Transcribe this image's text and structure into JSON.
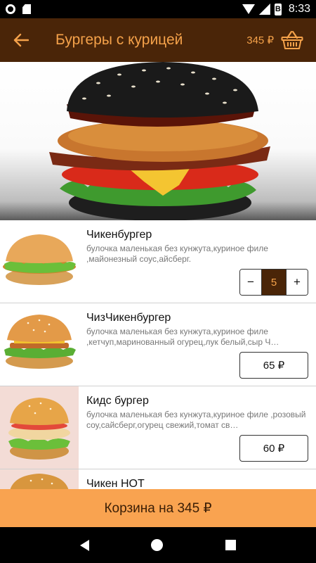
{
  "status_bar": {
    "time": "8:33",
    "battery_glyph": "B"
  },
  "app_bar": {
    "title": "Бургеры с курицей",
    "cart_total": "345 ₽"
  },
  "items": [
    {
      "name": "Чикенбургер",
      "description": "булочка маленькая без кунжута,куриное филе ,майонезный соус,айсберг.",
      "quantity": "5",
      "minus": "−",
      "plus": "+"
    },
    {
      "name": "ЧизЧикенбургер",
      "description": "булочка маленькая без кунжута,куриное филе ,кетчуп,маринованный огурец,лук белый,сыр Ч…",
      "price": "65 ₽"
    },
    {
      "name": "Кидс бургер",
      "description": "булочка маленькая без кунжута,куриное филе ,розовый соу,сайсберг,огурец свежий,томат св…",
      "price": "60 ₽"
    },
    {
      "name": "Чикен HOT"
    }
  ],
  "cart_bar": {
    "label": "Корзина на 345 ₽"
  },
  "colors": {
    "primary_dark": "#4a2508",
    "accent": "#f5a24a",
    "cart_bar": "#f9a350"
  }
}
